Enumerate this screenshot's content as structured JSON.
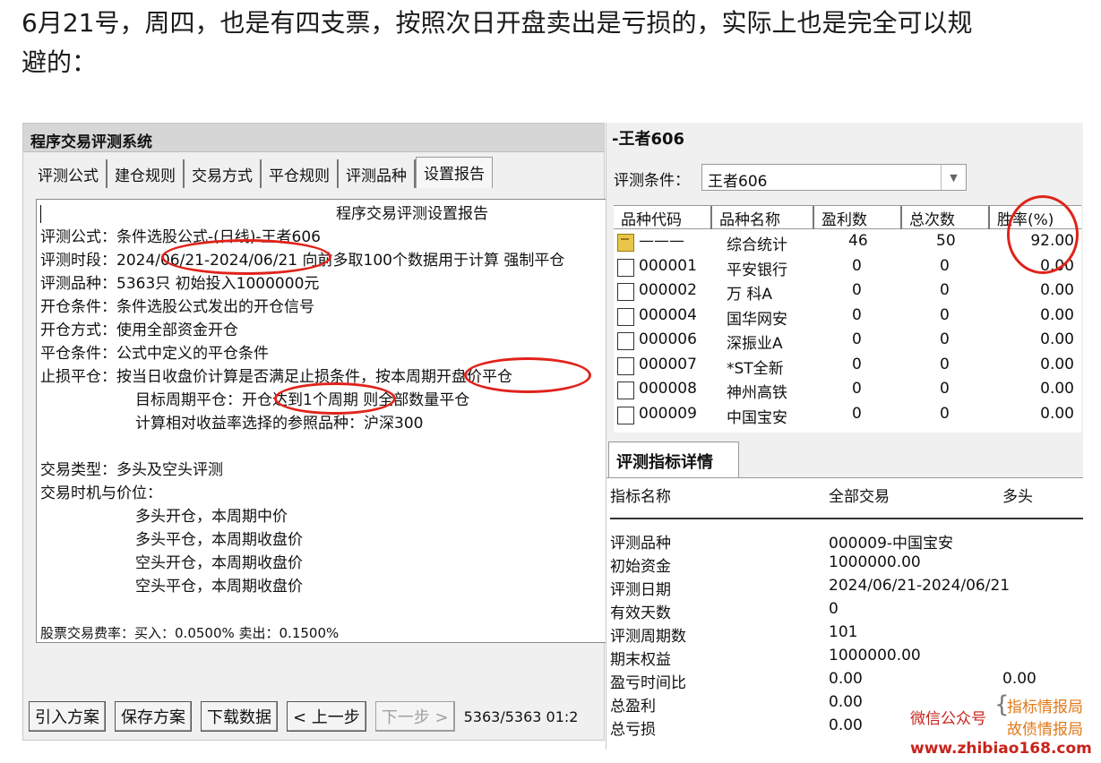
{
  "caption": {
    "line1": "6月21号，周四，也是有四支票，按照次日开盘卖出是亏损的，实际上也是完全可以规",
    "line2": "避的："
  },
  "left_window": {
    "title": "程序交易评测系统",
    "tabs": [
      {
        "label": "评测公式"
      },
      {
        "label": "建仓规则"
      },
      {
        "label": "交易方式"
      },
      {
        "label": "平仓规则"
      },
      {
        "label": "评测品种"
      },
      {
        "label": "设置报告",
        "active": true
      }
    ],
    "report": {
      "heading": "程序交易评测设置报告",
      "lines": [
        "评测公式：条件选股公式-(日线)-王者606",
        "评测时段：2024/06/21-2024/06/21 向前多取100个数据用于计算 强制平仓",
        "评测品种：5363只 初始投入1000000元",
        "开仓条件：条件选股公式发出的开仓信号",
        "开仓方式：使用全部资金开仓",
        "平仓条件：公式中定义的平仓条件",
        "止损平仓：按当日收盘价计算是否满足止损条件，按本周期开盘价平仓",
        "目标周期平仓：开仓达到1个周期 则全部数量平仓",
        "计算相对收益率选择的参照品种：沪深300",
        "交易类型：多头及空头评测",
        "交易时机与价位：",
        "多头开仓，本周期中价",
        "多头平仓，本周期收盘价",
        "空头开仓，本周期收盘价",
        "空头平仓，本周期收盘价",
        "股票交易费率：买入：0.0500%  卖出：0.1500%"
      ]
    },
    "buttons": {
      "import": "引入方案",
      "save": "保存方案",
      "download": "下载数据",
      "prev": "< 上一步",
      "next": "下一步 >"
    },
    "status": "5363/5363 01:2"
  },
  "right_window": {
    "title": "-王者606",
    "condition_label": "评测条件：",
    "condition_value": "王者606",
    "grid": {
      "headers": [
        "品种代码",
        "品种名称",
        "盈利数",
        "总次数",
        "胜率(%)"
      ],
      "rows": [
        {
          "code": "———",
          "name": "综合统计",
          "profit": "46",
          "total": "50",
          "rate": "92.00",
          "summary": true
        },
        {
          "code": "000001",
          "name": "平安银行",
          "profit": "0",
          "total": "0",
          "rate": "0.00"
        },
        {
          "code": "000002",
          "name": "万 科A",
          "profit": "0",
          "total": "0",
          "rate": "0.00"
        },
        {
          "code": "000004",
          "name": "国华网安",
          "profit": "0",
          "total": "0",
          "rate": "0.00"
        },
        {
          "code": "000006",
          "name": "深振业A",
          "profit": "0",
          "total": "0",
          "rate": "0.00"
        },
        {
          "code": "000007",
          "name": "*ST全新",
          "profit": "0",
          "total": "0",
          "rate": "0.00"
        },
        {
          "code": "000008",
          "name": "神州高铁",
          "profit": "0",
          "total": "0",
          "rate": "0.00"
        },
        {
          "code": "000009",
          "name": "中国宝安",
          "profit": "0",
          "total": "0",
          "rate": "0.00"
        }
      ]
    },
    "detail": {
      "tab": "评测指标详情",
      "headers": [
        "指标名称",
        "全部交易",
        "多头"
      ],
      "rows": [
        {
          "name": "评测品种",
          "all": "000009-中国宝安",
          "long": ""
        },
        {
          "name": "初始资金",
          "all": "1000000.00",
          "long": ""
        },
        {
          "name": "评测日期",
          "all": "2024/06/21-2024/06/21",
          "long": ""
        },
        {
          "name": "有效天数",
          "all": "0",
          "long": ""
        },
        {
          "name": "评测周期数",
          "all": "101",
          "long": ""
        },
        {
          "name": "期末权益",
          "all": "1000000.00",
          "long": ""
        },
        {
          "name": "盈亏时间比",
          "all": "0.00",
          "long": "0.00"
        },
        {
          "name": "总盈利",
          "all": "0.00",
          "long": ""
        },
        {
          "name": "总亏损",
          "all": "0.00",
          "long": ""
        }
      ]
    }
  },
  "watermark": {
    "label": "微信公众号",
    "name1": "指标情报局",
    "name2": "故债情报局",
    "url": "www.zhibiao168.com"
  },
  "colors": {
    "annotation": "#e0231b",
    "watermark_red": "#c8231b",
    "watermark_orange": "#e07a1a"
  }
}
